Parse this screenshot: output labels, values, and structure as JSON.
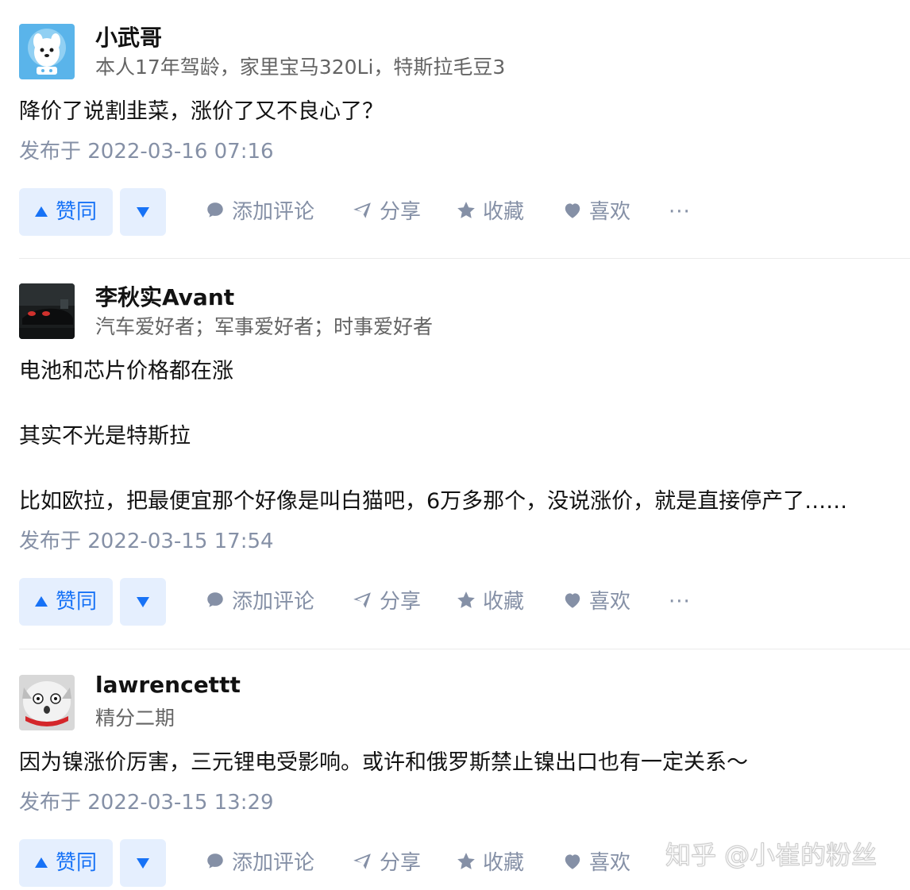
{
  "answers": [
    {
      "author_name": "小武哥",
      "author_bio": "本人17年驾龄，家里宝马320Li，特斯拉毛豆3",
      "paragraphs": [
        "降价了说割韭菜，涨价了又不良心了？"
      ],
      "time": "发布于 2022-03-16 07:16"
    },
    {
      "author_name": "李秋实Avant",
      "author_bio": "汽车爱好者；军事爱好者；时事爱好者",
      "paragraphs": [
        "电池和芯片价格都在涨",
        "其实不光是特斯拉",
        "比如欧拉，把最便宜那个好像是叫白猫吧，6万多那个，没说涨价，就是直接停产了……"
      ],
      "time": "发布于 2022-03-15 17:54"
    },
    {
      "author_name": "lawrencettt",
      "author_bio": "精分二期",
      "paragraphs": [
        "因为镍涨价厉害，三元锂电受影响。或许和俄罗斯禁止镍出口也有一定关系～"
      ],
      "time": "发布于 2022-03-15 13:29"
    }
  ],
  "actions": {
    "vote_up": "赞同",
    "comment": "添加评论",
    "share": "分享",
    "favorite": "收藏",
    "like": "喜欢",
    "more": "···"
  },
  "watermark": "知乎 @小崔的粉丝",
  "colors": {
    "primary": "#1772f6",
    "vote_bg": "#e5effe",
    "meta": "#8590a6",
    "text": "#121212"
  }
}
